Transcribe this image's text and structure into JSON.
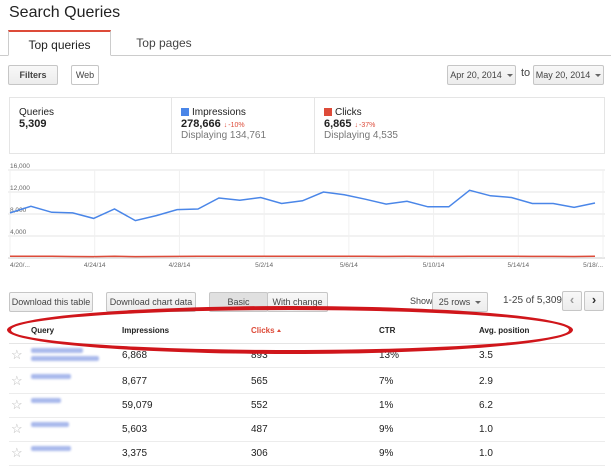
{
  "page": {
    "title": "Search Queries"
  },
  "tabs": [
    {
      "label": "Top queries",
      "active": true
    },
    {
      "label": "Top pages",
      "active": false
    }
  ],
  "filters": {
    "filters_label": "Filters",
    "web_label": "Web"
  },
  "date_range": {
    "start": "Apr 20, 2014",
    "separator": "to",
    "end": "May 20, 2014"
  },
  "stats": {
    "queries": {
      "label": "Queries",
      "value": "5,309"
    },
    "impressions": {
      "label": "Impressions",
      "value": "278,666",
      "delta": "-10%",
      "sub": "Displaying 134,761",
      "color": "#4a86e8"
    },
    "clicks": {
      "label": "Clicks",
      "value": "6,865",
      "delta": "-37%",
      "sub": "Displaying 4,535",
      "color": "#dd4b39"
    }
  },
  "chart_data": {
    "type": "line",
    "x_tick_labels": [
      "4/20/...",
      "4/24/14",
      "4/28/14",
      "5/2/14",
      "5/6/14",
      "5/10/14",
      "5/14/14",
      "5/18/..."
    ],
    "y_tick_labels": [
      "16,000",
      "12,000",
      "8,000",
      "4,000"
    ],
    "ylim": [
      0,
      16000
    ],
    "grid": true,
    "series": [
      {
        "values": [
          8200,
          9400,
          8300,
          8200,
          7200,
          8900,
          6800,
          7700,
          8800,
          8900,
          10900,
          10500,
          11000,
          9900,
          10400,
          12000,
          11500,
          10700,
          9800,
          10300,
          9300,
          9300,
          12300,
          11300,
          11000,
          9900,
          9900,
          9200,
          10000
        ],
        "color": "#4a86e8"
      },
      {
        "values": [
          300,
          300,
          300,
          280,
          260,
          300,
          260,
          270,
          290,
          300,
          310,
          300,
          310,
          300,
          300,
          320,
          310,
          300,
          290,
          300,
          290,
          290,
          320,
          310,
          300,
          290,
          290,
          280,
          300
        ],
        "color": "#dd4b39"
      }
    ]
  },
  "toolbar": {
    "download_table": "Download this table",
    "download_chart": "Download chart data",
    "basic": "Basic",
    "with_change": "With change",
    "show_label": "Show",
    "rows_select": "25 rows",
    "pager": "1-25 of 5,309",
    "prev_icon": "chevron-left-icon",
    "next_icon": "chevron-right-icon"
  },
  "table": {
    "headers": {
      "query": "Query",
      "impressions": "Impressions",
      "clicks": "Clicks",
      "ctr": "CTR",
      "avg_position": "Avg. position"
    },
    "rows": [
      {
        "impressions": "6,868",
        "clicks": "893",
        "ctr": "13%",
        "avg_position": "3.5"
      },
      {
        "impressions": "8,677",
        "clicks": "565",
        "ctr": "7%",
        "avg_position": "2.9"
      },
      {
        "impressions": "59,079",
        "clicks": "552",
        "ctr": "1%",
        "avg_position": "6.2"
      },
      {
        "impressions": "5,603",
        "clicks": "487",
        "ctr": "9%",
        "avg_position": "1.0"
      },
      {
        "impressions": "3,375",
        "clicks": "306",
        "ctr": "9%",
        "avg_position": "1.0"
      }
    ]
  }
}
